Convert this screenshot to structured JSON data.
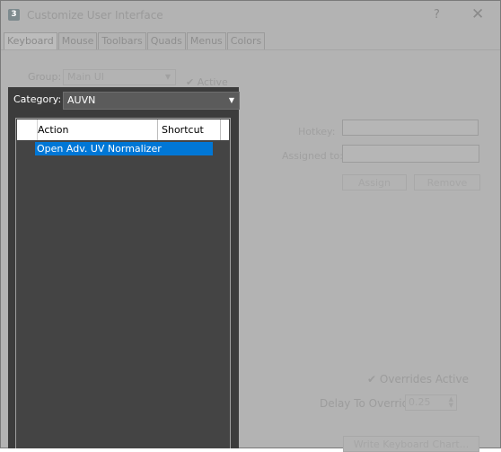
{
  "window": {
    "title": "Customize User Interface",
    "help_label": "?",
    "close_label": "✕"
  },
  "tabs": [
    {
      "label": "Keyboard"
    },
    {
      "label": "Mouse"
    },
    {
      "label": "Toolbars"
    },
    {
      "label": "Quads"
    },
    {
      "label": "Menus"
    },
    {
      "label": "Colors"
    }
  ],
  "group": {
    "label": "Group:",
    "value": "Main UI"
  },
  "active": {
    "label": "Active",
    "checked": true
  },
  "hotkey": {
    "label": "Hotkey:",
    "value": ""
  },
  "assigned_to": {
    "label": "Assigned to:",
    "value": ""
  },
  "buttons": {
    "assign": "Assign",
    "remove": "Remove",
    "write_chart": "Write Keyboard Chart..."
  },
  "overrides": {
    "label": "Overrides Active",
    "checked": true
  },
  "delay": {
    "label": "Delay To Override:",
    "value": "0.25"
  },
  "category_popup": {
    "label": "Category:",
    "value": "AUVN",
    "columns": [
      "Action",
      "Shortcut"
    ],
    "rows": [
      {
        "action": "Open Adv. UV Normalizer",
        "shortcut": "",
        "selected": true
      }
    ]
  },
  "colors": {
    "selection": "#0077d6",
    "popup_bg": "#3c3c3c",
    "window_bg": "#b3b3b3"
  }
}
